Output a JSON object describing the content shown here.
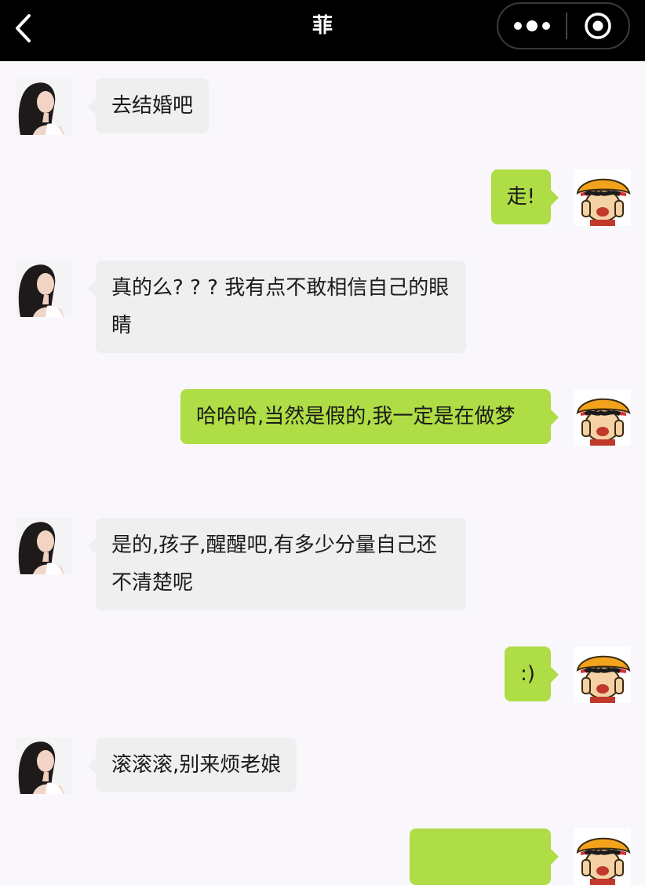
{
  "navbar": {
    "title": "菲",
    "back_icon": "chevron-left-icon",
    "more_icon": "more-dots-icon",
    "close_icon": "circle-target-icon",
    "background": "#000000"
  },
  "colors": {
    "page_background": "#f9f7fb",
    "left_bubble": "#efefef",
    "right_bubble": "#aedd45"
  },
  "messages": [
    {
      "side": "left",
      "text": "去结婚吧"
    },
    {
      "side": "right",
      "text": "走!"
    },
    {
      "side": "left",
      "text": "真的么? ? ? 我有点不敢相信自己的眼睛"
    },
    {
      "side": "right",
      "text": "哈哈哈,当然是假的,我一定是在做梦"
    },
    {
      "side": "left",
      "text": "是的,孩子,醒醒吧,有多少分量自己还不清楚呢"
    },
    {
      "side": "right",
      "text": ":)"
    },
    {
      "side": "left",
      "text": "滚滚滚,别来烦老娘"
    },
    {
      "side": "right",
      "text": ""
    }
  ]
}
